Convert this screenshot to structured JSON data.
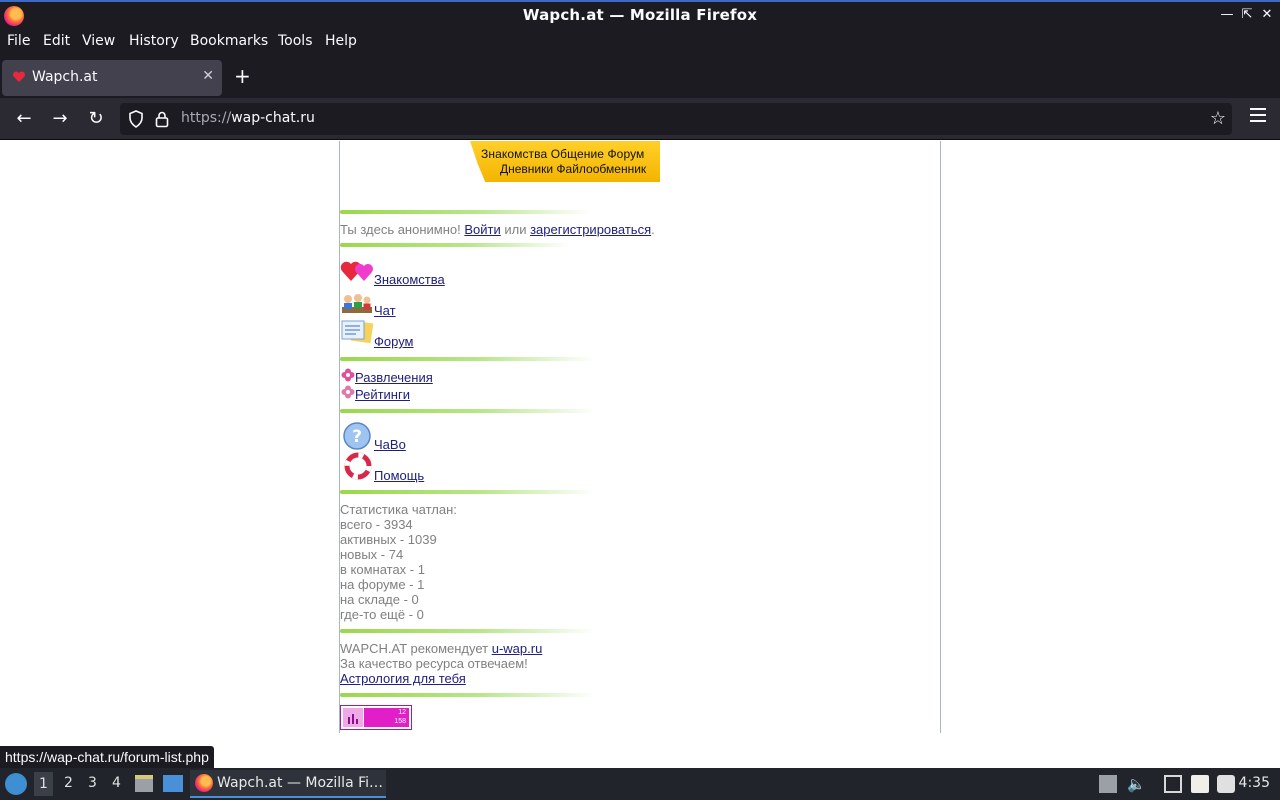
{
  "window": {
    "title": "Wapch.at — Mozilla Firefox"
  },
  "menu": [
    "File",
    "Edit",
    "View",
    "History",
    "Bookmarks",
    "Tools",
    "Help"
  ],
  "tab": {
    "label": "Wapch.at"
  },
  "urlbar": {
    "proto": "https://",
    "host": "wap-chat.ru"
  },
  "banner": {
    "line1": "Знакомства  Общение  Форум",
    "line2": "Дневники  Файлообменник"
  },
  "auth": {
    "prefix": "Ты здесь анонимно! ",
    "login": "Войти",
    "or": " или ",
    "register": "зарегистрироваться",
    "suffix": "."
  },
  "main_links": [
    {
      "label": "Знакомства",
      "icon": "hearts-icon"
    },
    {
      "label": "Чат",
      "icon": "people-chat-icon"
    },
    {
      "label": "Форум",
      "icon": "forum-notes-icon"
    }
  ],
  "extra_links": [
    "Развлечения",
    "Рейтинги"
  ],
  "help_links": [
    {
      "label": "ЧаВо",
      "icon": "question-icon"
    },
    {
      "label": "Помощь",
      "icon": "lifebuoy-icon"
    }
  ],
  "stats": {
    "title": "Статистика чатлан:",
    "lines": [
      "всего - 3934",
      "активных - 1039",
      "новых - 74",
      "в комнатах - 1",
      "на форуме - 1",
      "на складе - 0",
      "где-то ещё - 0"
    ]
  },
  "footer": {
    "recommend": "WAPCH.AT рекомендует ",
    "recommend_link": "u-wap.ru",
    "quality": "За качество ресурса отвечаем!",
    "astro": "Астрология для тебя"
  },
  "counter": {
    "top": "12",
    "bottom": "158"
  },
  "status_url": "https://wap-chat.ru/forum-list.php",
  "taskbar": {
    "workspaces": [
      "1",
      "2",
      "3",
      "4"
    ],
    "app_label": "Wapch.at — Mozilla Fi…",
    "clock": "4:35"
  },
  "colors": {
    "banner": "#ffcc22",
    "link": "#1a0dab",
    "separator": "#9ad84a",
    "counter": "#e11ec8"
  }
}
